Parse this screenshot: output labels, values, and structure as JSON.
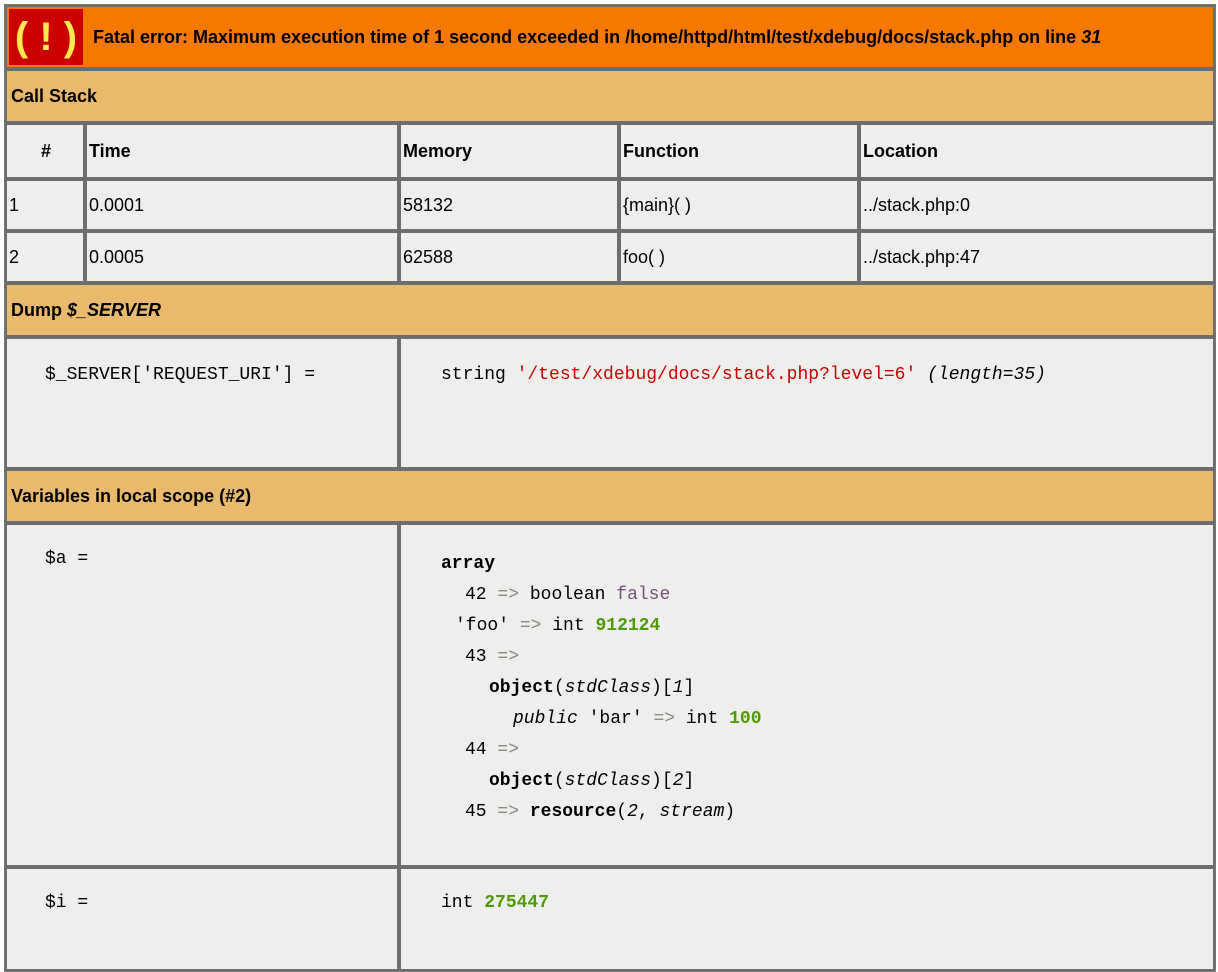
{
  "error": {
    "icon": "( ! )",
    "message": "Fatal error: Maximum execution time of 1 second exceeded in /home/httpd/html/test/xdebug/docs/stack.php on line ",
    "line": "31"
  },
  "call_stack": {
    "title": "Call Stack",
    "headers": [
      "#",
      "Time",
      "Memory",
      "Function",
      "Location"
    ],
    "rows": [
      [
        "1",
        "0.0001",
        "58132",
        "{main}( )",
        "../stack.php:0"
      ],
      [
        "2",
        "0.0005",
        "62588",
        "foo( )",
        "../stack.php:47"
      ]
    ]
  },
  "dump_server": {
    "title_prefix": "Dump ",
    "title_var": "$_SERVER",
    "key": "$_SERVER['REQUEST_URI'] =",
    "type": "string",
    "value": "'/test/xdebug/docs/stack.php?level=6'",
    "length": "(length=35)"
  },
  "locals": {
    "title": "Variables in local scope (#2)",
    "a_key": "$a =",
    "a": {
      "type": "array",
      "l1_key": "42",
      "l1_type": "boolean",
      "l1_val": "false",
      "l2_key": "'foo'",
      "l2_type": "int",
      "l2_val": "912124",
      "l3_key": "43",
      "l4_obj": "object",
      "l4_class": "stdClass",
      "l4_id": "1",
      "l5_vis": "public",
      "l5_key": "'bar'",
      "l5_type": "int",
      "l5_val": "100",
      "l6_key": "44",
      "l7_obj": "object",
      "l7_class": "stdClass",
      "l7_id": "2",
      "l8_key": "45",
      "l8_res": "resource",
      "l8_id": "2",
      "l8_kind": "stream",
      "arrow": "=>"
    },
    "i_key": "$i =",
    "i_type": "int",
    "i_val": "275447"
  }
}
